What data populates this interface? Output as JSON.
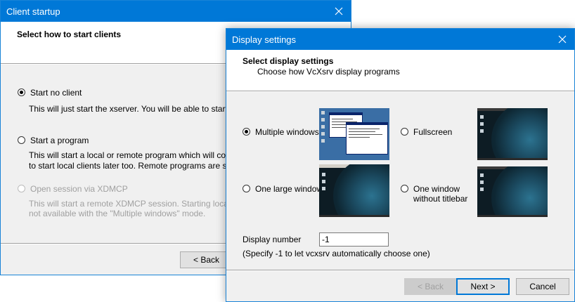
{
  "back_window": {
    "title": "Client startup",
    "heading": "Select how to start clients",
    "options": [
      {
        "label": "Start no client",
        "checked": true,
        "disabled": false,
        "desc1": "This will just start the xserver. You will be able to start local c",
        "desc2": ""
      },
      {
        "label": "Start a program",
        "checked": false,
        "disabled": false,
        "desc1": "This will start a local or remote program which will connect to",
        "desc2": "to start local clients later too. Remote programs are started u"
      },
      {
        "label": "Open session via XDMCP",
        "checked": false,
        "disabled": true,
        "desc1": "This will start a remote XDMCP session. Starting local clients",
        "desc2": "not available with the \"Multiple windows\" mode."
      }
    ],
    "back_label": "< Back"
  },
  "front_window": {
    "title": "Display settings",
    "heading": "Select display settings",
    "subheading": "Choose how VcXsrv display programs",
    "modes": [
      {
        "label": "Multiple windows",
        "checked": true
      },
      {
        "label": "Fullscreen",
        "checked": false
      },
      {
        "label": "One large window",
        "checked": false
      },
      {
        "label": "One window",
        "label2": "without titlebar",
        "checked": false
      }
    ],
    "display_number_label": "Display number",
    "display_number_value": "-1",
    "hint": "(Specify -1 to let vcxsrv automatically choose one)",
    "buttons": {
      "back": "< Back",
      "next": "Next >",
      "cancel": "Cancel"
    }
  },
  "colors": {
    "titlebar": "#0078d7",
    "dialog_bg": "#f0f0f0",
    "accent": "#0078d7"
  },
  "icons": {
    "close": "close-icon"
  }
}
